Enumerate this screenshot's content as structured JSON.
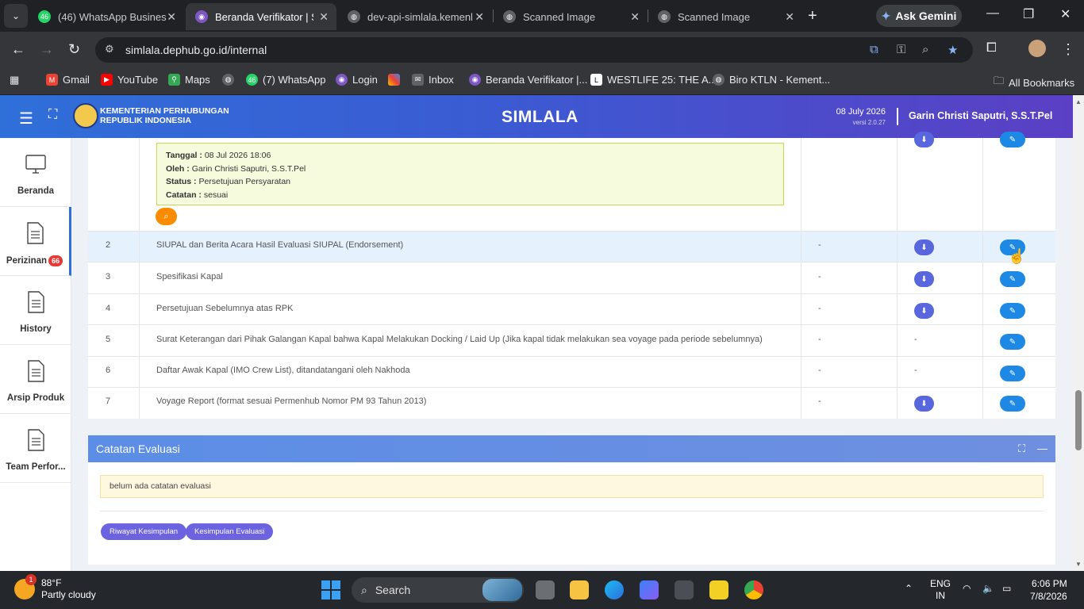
{
  "browser": {
    "tabs": [
      {
        "title": "(46) WhatsApp Busines",
        "badge": "46"
      },
      {
        "title": "Beranda Verifikator | Si",
        "active": true
      },
      {
        "title": "dev-api-simlala.kemenl"
      },
      {
        "title": "Scanned Image"
      },
      {
        "title": "Scanned Image"
      }
    ],
    "gemini_label": "Ask Gemini",
    "url": "simlala.dephub.go.id/internal",
    "bookmarks": [
      {
        "label": "Gmail"
      },
      {
        "label": "YouTube"
      },
      {
        "label": "Maps"
      },
      {
        "label": ""
      },
      {
        "label": "(7) WhatsApp"
      },
      {
        "label": "Login"
      },
      {
        "label": ""
      },
      {
        "label": "Inbox"
      },
      {
        "label": "Beranda Verifikator |..."
      },
      {
        "label": "WESTLIFE 25: THE A..."
      },
      {
        "label": "Biro KTLN - Kement..."
      }
    ],
    "all_bookmarks": "All Bookmarks"
  },
  "header": {
    "ministry_line1": "KEMENTERIAN PERHUBUNGAN",
    "ministry_line2": "REPUBLIK INDONESIA",
    "brand": "SIMLALA",
    "date": "08 July 2026",
    "version": "versi 2.0.27",
    "user": "Garin Christi Saputri, S.S.T.Pel"
  },
  "sidebar": {
    "items": [
      {
        "label": "Beranda"
      },
      {
        "label": "Perizinan",
        "badge": "66",
        "active": true
      },
      {
        "label": "History"
      },
      {
        "label": "Arsip Produk"
      },
      {
        "label": "Team Perfor..."
      }
    ]
  },
  "requirements": {
    "info": {
      "tanggal_label": "Tanggal :",
      "tanggal": "08 Jul 2026 18:06",
      "oleh_label": "Oleh :",
      "oleh": "Garin Christi Saputri, S.S.T.Pel",
      "status_label": "Status :",
      "status": "Persetujuan Persyaratan",
      "catatan_label": "Catatan :",
      "catatan": "sesuai"
    },
    "rows": [
      {
        "no": "2",
        "text": "SIUPAL dan Berita Acara Hasil Evaluasi SIUPAL (Endorsement)",
        "col3": "-",
        "download": true
      },
      {
        "no": "3",
        "text": "Spesifikasi Kapal",
        "col3": "-",
        "download": true
      },
      {
        "no": "4",
        "text": "Persetujuan Sebelumnya atas RPK",
        "col3": "-",
        "download": true
      },
      {
        "no": "5",
        "text": "Surat Keterangan dari Pihak Galangan Kapal bahwa Kapal Melakukan Docking / Laid Up (Jika kapal tidak melakukan sea voyage pada periode sebelumnya)",
        "col3": "-",
        "download": false,
        "col4": "-"
      },
      {
        "no": "6",
        "text": "Daftar Awak Kapal (IMO Crew List), ditandatangani oleh Nakhoda",
        "col3": "-",
        "download": false,
        "col4": "-"
      },
      {
        "no": "7",
        "text": "Voyage Report (format sesuai Permenhub Nomor PM 93 Tahun 2013)",
        "col3": "-",
        "download": true
      }
    ]
  },
  "evaluation": {
    "title": "Catatan Evaluasi",
    "note": "belum ada catatan evaluasi",
    "btn_riwayat": "Riwayat Kesimpulan",
    "btn_kesimpulan": "Kesimpulan Evaluasi"
  },
  "taskbar": {
    "temp": "88°F",
    "weather": "Partly cloudy",
    "weather_badge": "1",
    "search": "Search",
    "lang1": "ENG",
    "lang2": "IN",
    "time": "6:06 PM",
    "date": "7/8/2026"
  },
  "colors": {
    "header_start": "#2f6fd8",
    "header_end": "#5b3fc4",
    "download_button": "#5867dd",
    "edit_button": "#1e88e5",
    "zoom_button": "#fb8c00"
  }
}
